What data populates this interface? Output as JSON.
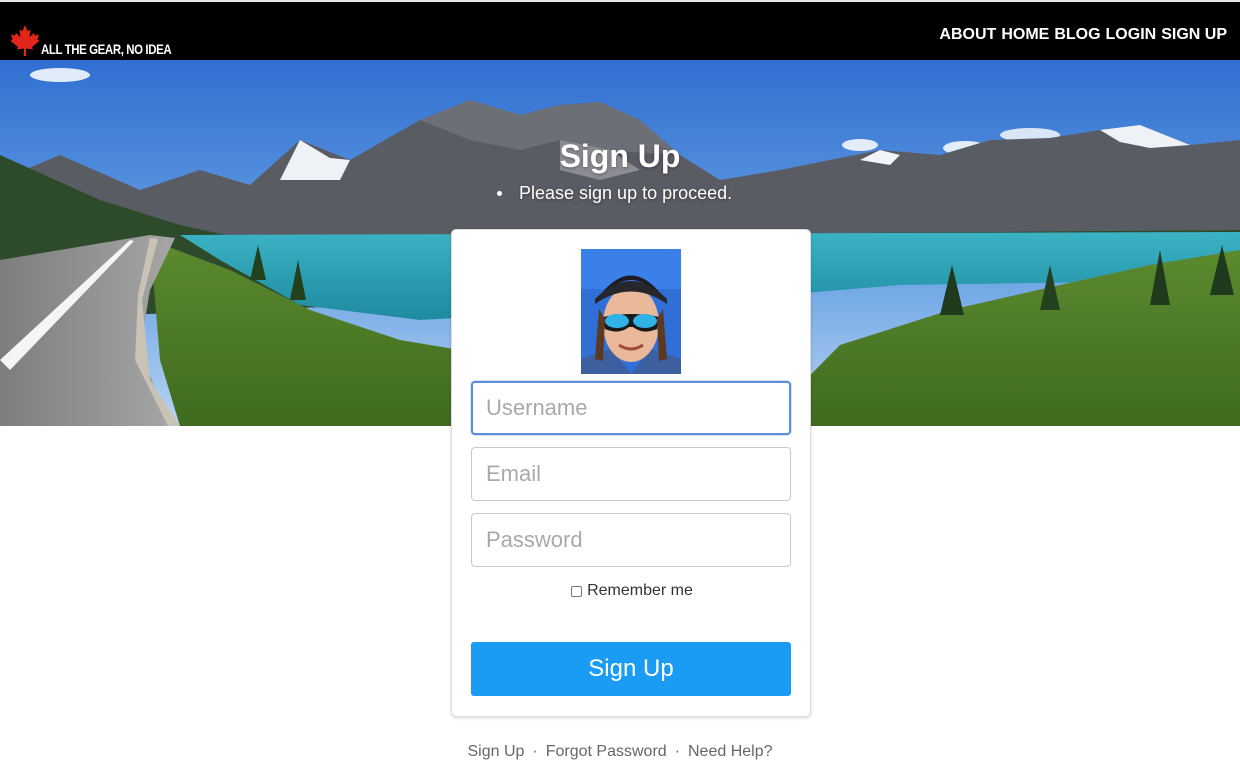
{
  "header": {
    "brand_text": "ALL THE GEAR, NO IDEA",
    "brand_icon": "maple-leaf-icon",
    "nav": [
      "ABOUT",
      "HOME",
      "BLOG",
      "LOGIN",
      "SIGN UP"
    ]
  },
  "hero": {
    "title": "Sign Up",
    "subtitle": "Please sign up to proceed."
  },
  "form": {
    "username_placeholder": "Username",
    "email_placeholder": "Email",
    "password_placeholder": "Password",
    "remember_label": "Remember me",
    "remember_checked": false,
    "submit_label": "Sign Up"
  },
  "footer": {
    "links": [
      "Sign Up",
      "Forgot Password",
      "Need Help?"
    ],
    "separator": "·"
  },
  "colors": {
    "header_bg": "#000000",
    "accent": "#1a9bf4",
    "maple_red": "#e1261c"
  }
}
